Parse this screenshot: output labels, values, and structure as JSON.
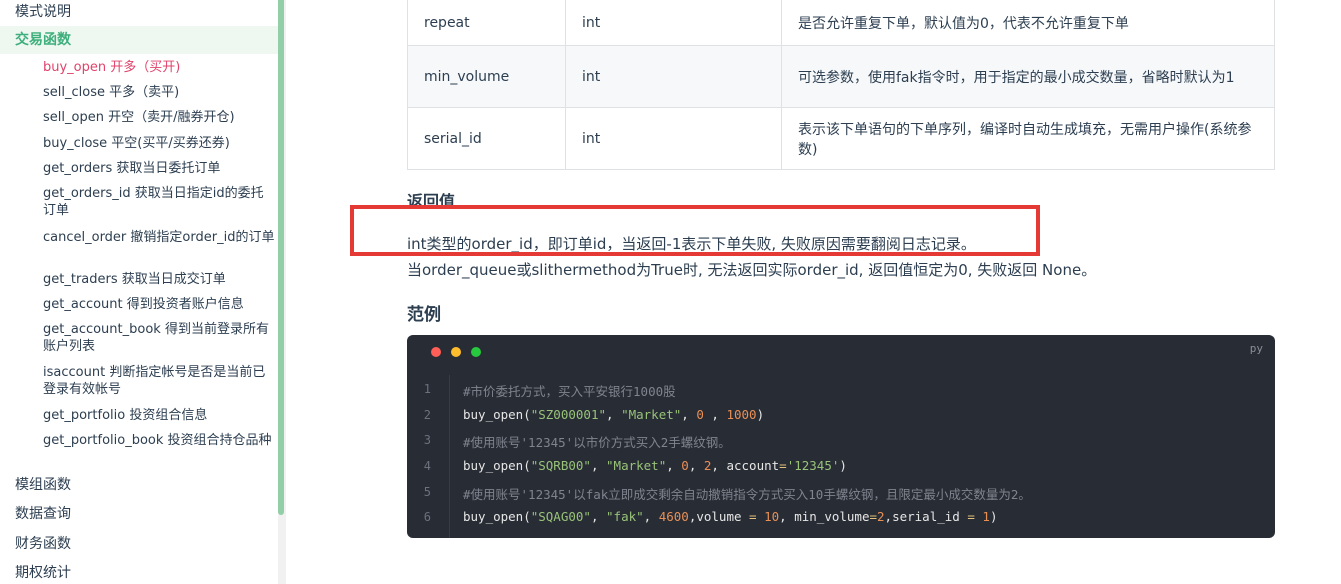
{
  "sidebar": {
    "top_item": "模式说明",
    "active_section": "交易函数",
    "items": [
      {
        "fn": "buy_open",
        "desc": " 开多（买开)"
      },
      {
        "fn": "sell_close",
        "desc": " 平多（卖平)"
      },
      {
        "fn": "sell_open",
        "desc": " 开空（卖开/融券开仓)"
      },
      {
        "fn": "buy_close",
        "desc": " 平空(买平/买券还券)"
      },
      {
        "fn": "get_orders",
        "desc": " 获取当日委托订单"
      },
      {
        "fn": "get_orders_id",
        "desc": " 获取当日指定id的委托订单"
      },
      {
        "fn": "cancel_order",
        "desc": " 撤销指定order_id的订单"
      },
      {
        "fn": "get_traders",
        "desc": " 获取当日成交订单"
      },
      {
        "fn": "get_account",
        "desc": " 得到投资者账户信息"
      },
      {
        "fn": "get_account_book",
        "desc": " 得到当前登录所有账户列表"
      },
      {
        "fn": "isaccount",
        "desc": " 判断指定帐号是否是当前已登录有效帐号"
      },
      {
        "fn": "get_portfolio",
        "desc": " 投资组合信息"
      },
      {
        "fn": "get_portfolio_book",
        "desc": " 投资组合持仓品种"
      }
    ],
    "bottom_sections": [
      "模组函数",
      "数据查询",
      "财务函数",
      "期权统计"
    ]
  },
  "params_table": {
    "rows": [
      {
        "name": "repeat",
        "type": "int",
        "desc": "是否允许重复下单，默认值为0，代表不允许重复下单"
      },
      {
        "name": "min_volume",
        "type": "int",
        "desc": "可选参数，使用fak指令时，用于指定的最小成交数量，省略时默认为1"
      },
      {
        "name": "serial_id",
        "type": "int",
        "desc": "表示该下单语句的下单序列，编译时自动生成填充，无需用户操作(系统参数)"
      }
    ]
  },
  "return_section": {
    "heading": "返回值",
    "line1": "int类型的order_id，即订单id，当返回-1表示下单失败, 失败原因需要翻阅日志记录。",
    "line2": "当order_queue或slithermethod为True时, 无法返回实际order_id, 返回值恒定为0, 失败返回 None。"
  },
  "example_section": {
    "heading": "范例",
    "code_lang": "py",
    "line_numbers": [
      "1",
      "2",
      "3",
      "4",
      "5",
      "6"
    ],
    "code": {
      "l1_comment": "#市价委托方式，买入平安银行1000股",
      "l2_fn": "buy_open(",
      "l2_s1": "\"SZ000001\"",
      "l2_sep1": ", ",
      "l2_s2": "\"Market\"",
      "l2_sep2": ", ",
      "l2_n1": "0",
      "l2_sep3": " , ",
      "l2_n2": "1000",
      "l2_end": ")",
      "l3_comment": "#使用账号'12345'以市价方式买入2手螺纹钢。",
      "l4_fn": "buy_open(",
      "l4_s1": "\"SQRB00\"",
      "l4_sep1": ", ",
      "l4_s2": "\"Market\"",
      "l4_sep2": ", ",
      "l4_n1": "0",
      "l4_sep3": ", ",
      "l4_n2": "2",
      "l4_sep4": ", account",
      "l4_eq": "=",
      "l4_s3": "'12345'",
      "l4_end": ")",
      "l5_comment": "#使用账号'12345'以fak立即成交剩余自动撤销指令方式买入10手螺纹钢，且限定最小成交数量为2。",
      "l6_fn": "buy_open(",
      "l6_s1": "\"SQAG00\"",
      "l6_sep1": ", ",
      "l6_s2": "\"fak\"",
      "l6_sep2": ", ",
      "l6_n1": "4600",
      "l6_sep3": ",volume ",
      "l6_eq1": "=",
      "l6_sp1": " ",
      "l6_n2": "10",
      "l6_sep4": ", min_volume",
      "l6_eq2": "=",
      "l6_n3": "2",
      "l6_sep5": ",serial_id ",
      "l6_eq3": "=",
      "l6_sp2": " ",
      "l6_n4": "1",
      "l6_end": ")"
    }
  },
  "colors": {
    "accent": "#3eaf7c",
    "current_link": "#e0436b",
    "highlight_box": "#e53935",
    "code_bg": "#282c34"
  }
}
